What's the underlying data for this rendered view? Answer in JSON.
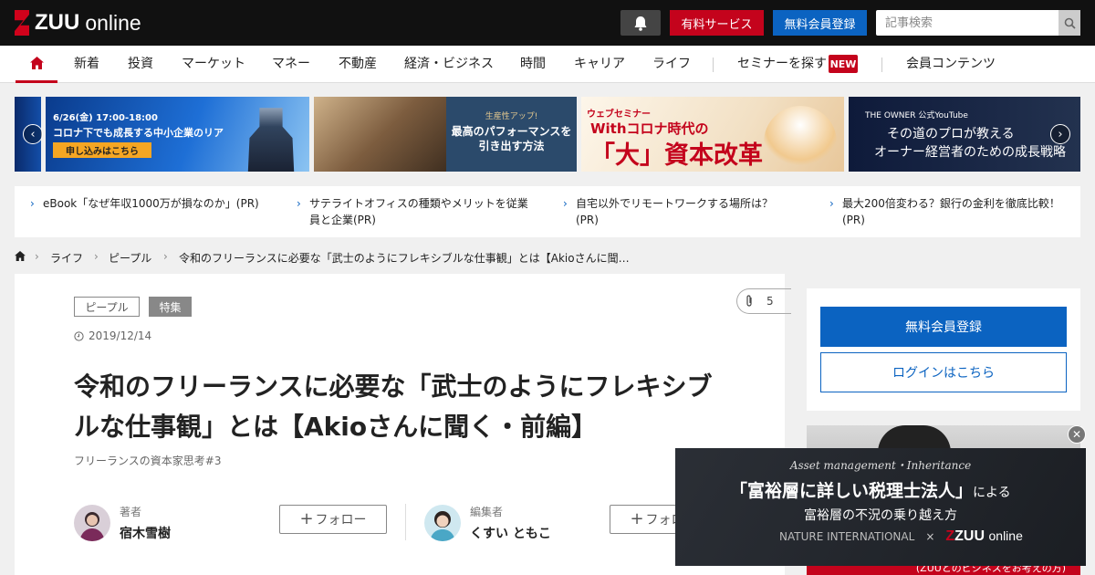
{
  "header": {
    "logo_main": "ZUU",
    "logo_sub": "online",
    "paid_service": "有料サービス",
    "free_register": "無料会員登録",
    "search_placeholder": "記事検索"
  },
  "nav": {
    "items": [
      "新着",
      "投資",
      "マーケット",
      "マネー",
      "不動産",
      "経済・ビジネス",
      "時間",
      "キャリア",
      "ライフ"
    ],
    "seminar": "セミナーを探す",
    "new_badge": "NEW",
    "member": "会員コンテンツ"
  },
  "banners": {
    "b1_date": "6/26(金) 17:00-18:00",
    "b1_title": "コロナ下でも成長する中小企業のリアル",
    "b1_cta": "申し込みはこちら",
    "b2_sub": "生産性アップ!",
    "b2_title": "最高のパフォーマンスを引き出す方法",
    "b3_tag": "ウェブセミナー",
    "b3_title1": "Withコロナ時代の",
    "b3_title2": "「大」資本改革",
    "b4_sub": "THE OWNER 公式YouTube",
    "b4_title1": "その道のプロが教える",
    "b4_title2": "オーナー経営者のための成長戦略"
  },
  "promo_links": [
    "eBook「なぜ年収1000万が損なのか」(PR)",
    "サテライトオフィスの種類やメリットを従業員と企業(PR)",
    "自宅以外でリモートワークする場所は？(PR)",
    "最大200倍変わる？銀行の金利を徹底比較！(PR)"
  ],
  "breadcrumb": {
    "items": [
      "ライフ",
      "ピープル",
      "令和のフリーランスに必要な「武士のようにフレキシブルな仕事観」とは【Akioさんに聞…"
    ]
  },
  "article": {
    "tags": [
      "ピープル",
      "特集"
    ],
    "clip_count": "5",
    "date": "2019/12/14",
    "title": "令和のフリーランスに必要な「武士のようにフレキシブルな仕事観」とは【Akioさんに聞く・前編】",
    "series": "フリーランスの資本家思考#3",
    "author_role": "著者",
    "author_name": "宿木雪樹",
    "editor_role": "編集者",
    "editor_name": "くすい ともこ",
    "follow": "フォロー"
  },
  "sidebar": {
    "register": "無料会員登録",
    "login": "ログインはこちら",
    "ad_bottom": "(ZUUとのビジネスをお考えの方)"
  },
  "float_ad": {
    "sub": "Asset management・Inheritance",
    "main": "「富裕層に詳しい税理士法人」",
    "main_suffix": "による",
    "line2": "富裕層の不況の乗り越え方",
    "partner": "NATURE INTERNATIONAL",
    "x": "×",
    "zuu": "ZUU",
    "zuu_sub": "online"
  },
  "colors": {
    "brand_red": "#c4031c",
    "brand_blue": "#0b63c1",
    "topbar": "#111111"
  }
}
